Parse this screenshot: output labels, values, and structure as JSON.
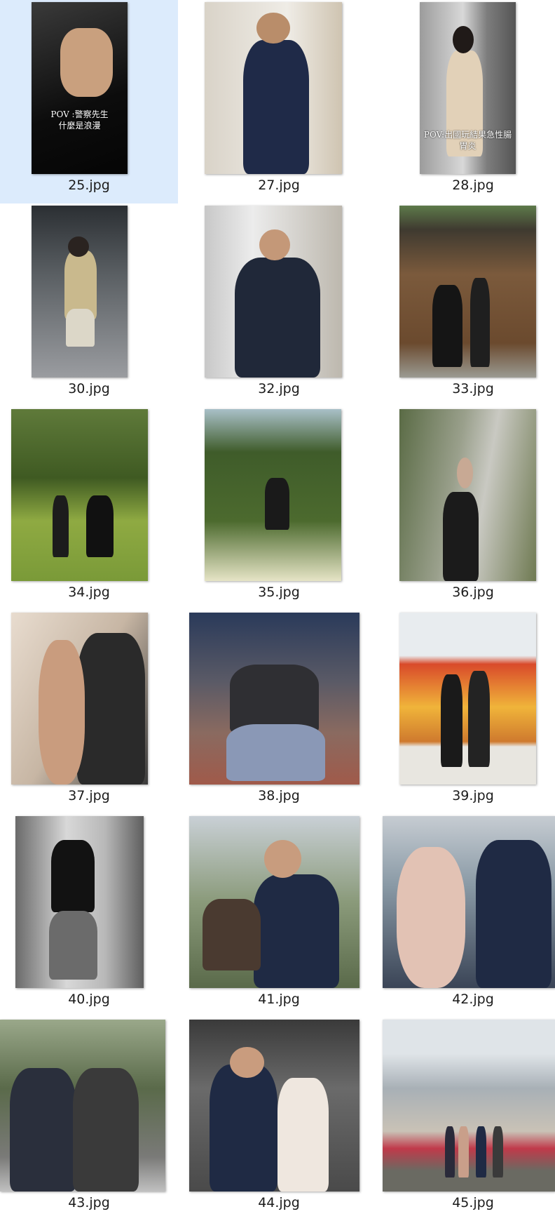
{
  "items": [
    {
      "name": "25.jpg",
      "selected": true,
      "scene": "phone",
      "overlay": [
        "POV :警察先生",
        "什麼是浪漫"
      ]
    },
    {
      "name": "27.jpg",
      "scene": "officer-room"
    },
    {
      "name": "28.jpg",
      "scene": "elevator",
      "overlay": [
        "POV:出國玩結果急性腸胃炎"
      ]
    },
    {
      "name": "30.jpg",
      "scene": "gym"
    },
    {
      "name": "32.jpg",
      "scene": "officer-elevator"
    },
    {
      "name": "33.jpg",
      "scene": "wedding-door"
    },
    {
      "name": "34.jpg",
      "scene": "park"
    },
    {
      "name": "35.jpg",
      "scene": "field"
    },
    {
      "name": "36.jpg",
      "scene": "street"
    },
    {
      "name": "37.jpg",
      "scene": "couple-close"
    },
    {
      "name": "38.jpg",
      "scene": "night-sit"
    },
    {
      "name": "39.jpg",
      "scene": "mural"
    },
    {
      "name": "40.jpg",
      "scene": "gym2"
    },
    {
      "name": "41.jpg",
      "scene": "graduate"
    },
    {
      "name": "42.jpg",
      "scene": "selfie"
    },
    {
      "name": "43.jpg",
      "scene": "friends"
    },
    {
      "name": "44.jpg",
      "scene": "crowd"
    },
    {
      "name": "45.jpg",
      "scene": "gate"
    }
  ]
}
